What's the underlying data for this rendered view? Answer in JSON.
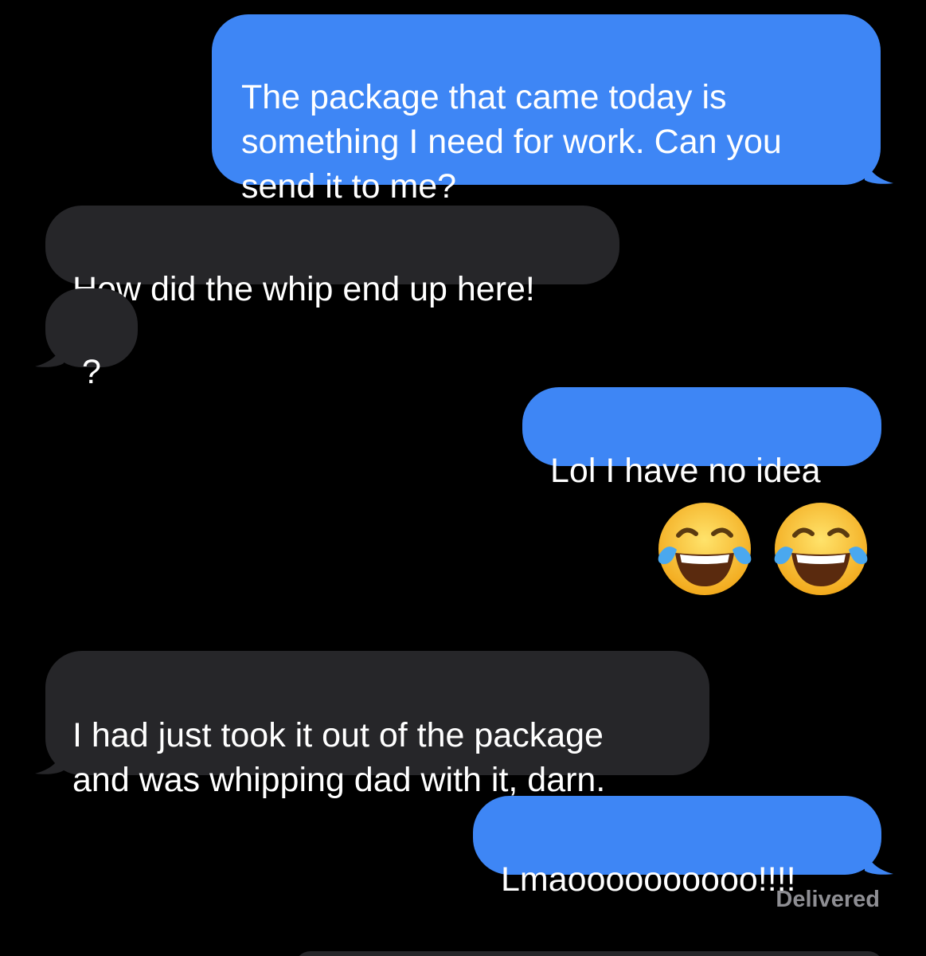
{
  "messages": [
    {
      "id": "m1",
      "direction": "outgoing",
      "text": "The package that came today is\nsomething I need for work. Can you\nsend it to me?"
    },
    {
      "id": "m2",
      "direction": "incoming",
      "text": "How did the whip end up here!"
    },
    {
      "id": "m3",
      "direction": "incoming",
      "text": "?"
    },
    {
      "id": "m4",
      "direction": "outgoing",
      "text": "Lol I have no idea"
    },
    {
      "id": "m5",
      "direction": "outgoing",
      "type": "emoji",
      "emoji": [
        "face-with-tears-of-joy",
        "face-with-tears-of-joy"
      ]
    },
    {
      "id": "m6",
      "direction": "incoming",
      "text": "I had just took it out of the package\nand was whipping dad with it, darn."
    },
    {
      "id": "m7",
      "direction": "outgoing",
      "text": "Lmaoooooooooo!!!!"
    }
  ],
  "status": {
    "delivered_label": "Delivered"
  },
  "colors": {
    "background": "#000000",
    "outgoing_bubble": "#3e86f5",
    "incoming_bubble": "#262629",
    "status_text": "#8e8e93"
  }
}
